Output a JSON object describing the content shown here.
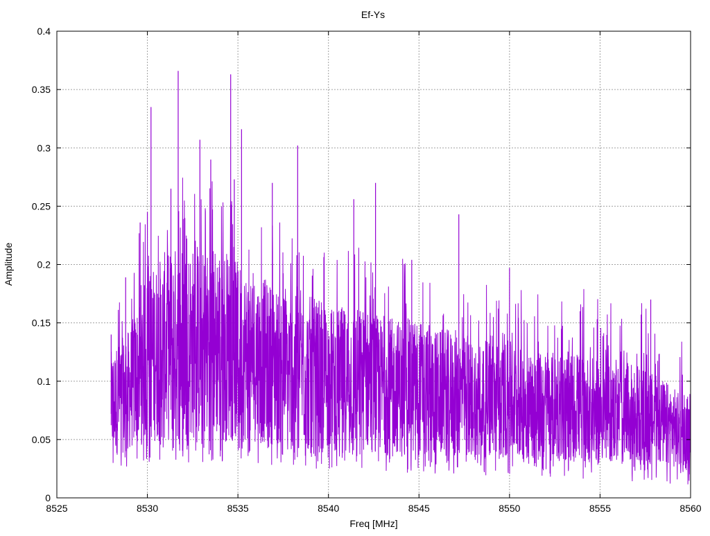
{
  "chart_data": {
    "type": "line",
    "title": "Ef-Ys",
    "xlabel": "Freq [MHz]",
    "ylabel": "Amplitude",
    "xlim": [
      8525,
      8560
    ],
    "ylim": [
      0,
      0.4
    ],
    "grid": true,
    "legend": "none",
    "series_color": "#9400d3",
    "xticks": [
      "8525",
      "8530",
      "8535",
      "8540",
      "8545",
      "8550",
      "8555",
      "8560"
    ],
    "yticks": [
      "0",
      "0.05",
      "0.1",
      "0.15",
      "0.2",
      "0.25",
      "0.3",
      "0.35",
      "0.4"
    ],
    "band": {
      "x": [
        8528,
        8529,
        8530,
        8531,
        8532,
        8533,
        8534,
        8535,
        8536,
        8537,
        8538,
        8539,
        8540,
        8541,
        8542,
        8543,
        8544,
        8545,
        8546,
        8547,
        8548,
        8549,
        8550,
        8551,
        8552,
        8553,
        8554,
        8555,
        8556,
        8557,
        8558,
        8559,
        8560
      ],
      "upper": [
        0.12,
        0.14,
        0.19,
        0.21,
        0.22,
        0.21,
        0.22,
        0.2,
        0.19,
        0.18,
        0.17,
        0.17,
        0.16,
        0.16,
        0.16,
        0.15,
        0.15,
        0.15,
        0.14,
        0.14,
        0.13,
        0.13,
        0.13,
        0.12,
        0.12,
        0.12,
        0.12,
        0.11,
        0.11,
        0.11,
        0.1,
        0.09,
        0.07
      ],
      "lower": [
        0.02,
        0.025,
        0.03,
        0.03,
        0.03,
        0.03,
        0.03,
        0.03,
        0.03,
        0.028,
        0.026,
        0.025,
        0.025,
        0.024,
        0.023,
        0.022,
        0.022,
        0.02,
        0.02,
        0.02,
        0.02,
        0.019,
        0.018,
        0.018,
        0.017,
        0.016,
        0.016,
        0.015,
        0.015,
        0.014,
        0.013,
        0.012,
        0.01
      ]
    },
    "peaks": [
      [
        8528.0,
        0.14
      ],
      [
        8528.8,
        0.189
      ],
      [
        8529.6,
        0.236
      ],
      [
        8530.0,
        0.245
      ],
      [
        8530.2,
        0.335
      ],
      [
        8531.3,
        0.265
      ],
      [
        8531.7,
        0.366
      ],
      [
        8532.9,
        0.307
      ],
      [
        8533.5,
        0.29
      ],
      [
        8534.6,
        0.363
      ],
      [
        8534.8,
        0.273
      ],
      [
        8535.2,
        0.316
      ],
      [
        8536.9,
        0.27
      ],
      [
        8538.3,
        0.302
      ],
      [
        8541.4,
        0.256
      ],
      [
        8542.6,
        0.27
      ],
      [
        8547.2,
        0.243
      ],
      [
        8544.6,
        0.204
      ],
      [
        8550.0,
        0.197
      ],
      [
        8557.8,
        0.17
      ],
      [
        8553.9,
        0.16
      ]
    ]
  }
}
